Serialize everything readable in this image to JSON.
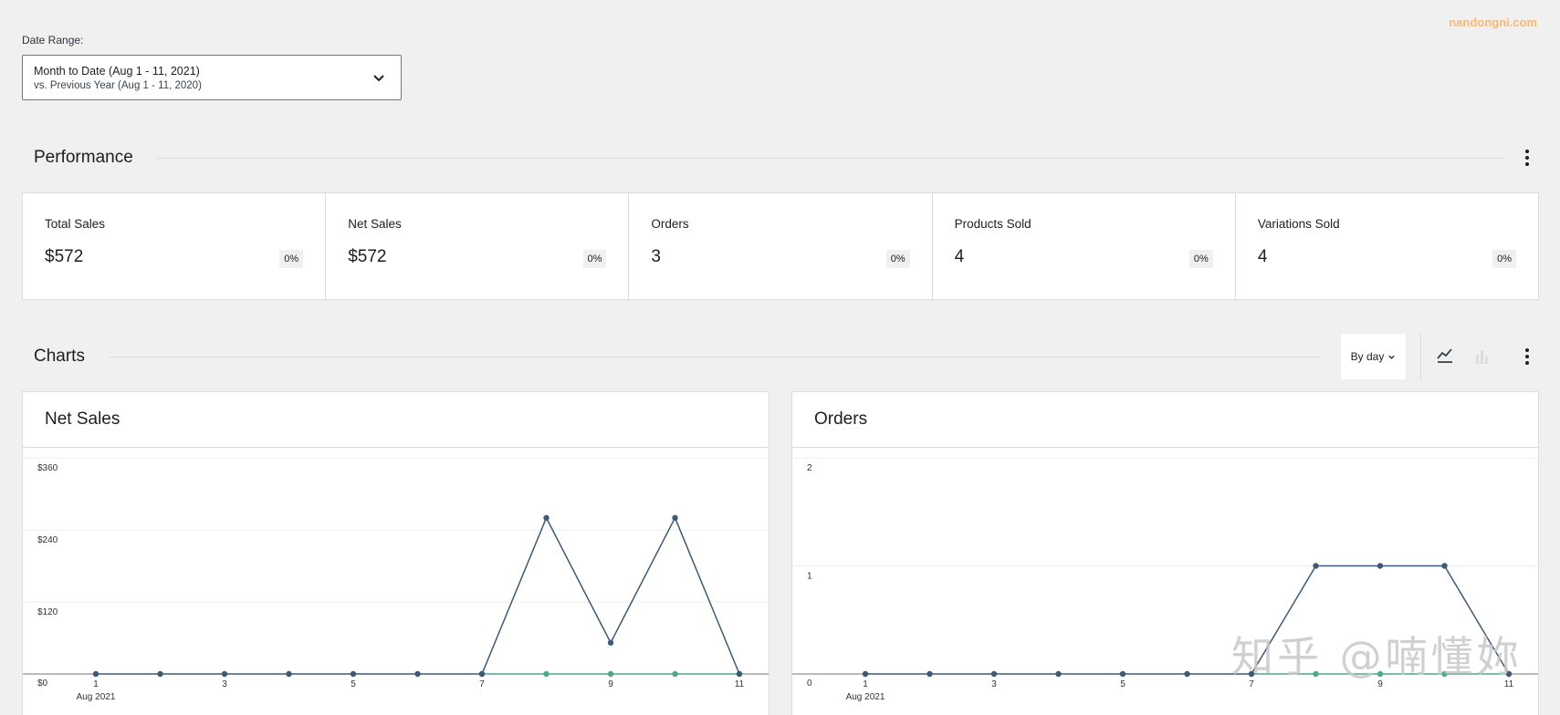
{
  "watermark_top": "nandongni.com",
  "watermark_bottom": "知乎 @喃懂妳",
  "date_range": {
    "label": "Date Range:",
    "primary": "Month to Date (Aug 1 - 11, 2021)",
    "secondary": "vs. Previous Year (Aug 1 - 11, 2020)"
  },
  "performance": {
    "title": "Performance",
    "cards": [
      {
        "label": "Total Sales",
        "value": "$572",
        "delta": "0%"
      },
      {
        "label": "Net Sales",
        "value": "$572",
        "delta": "0%"
      },
      {
        "label": "Orders",
        "value": "3",
        "delta": "0%"
      },
      {
        "label": "Products Sold",
        "value": "4",
        "delta": "0%"
      },
      {
        "label": "Variations Sold",
        "value": "4",
        "delta": "0%"
      }
    ]
  },
  "charts_section": {
    "title": "Charts",
    "interval": "By day"
  },
  "colors": {
    "current_series": "#3d5a74",
    "previous_series": "#4ea98a",
    "accent_watermark": "#f5b979"
  },
  "chart_data": [
    {
      "type": "line",
      "title": "Net Sales",
      "x": [
        1,
        2,
        3,
        4,
        5,
        6,
        7,
        8,
        9,
        10,
        11
      ],
      "x_tick_labels": [
        "1",
        "3",
        "5",
        "7",
        "9",
        "11"
      ],
      "x_first_sub": "Aug 2021",
      "y_ticks": [
        "$0",
        "$120",
        "$240",
        "$360"
      ],
      "ylim": [
        0,
        360
      ],
      "series": [
        {
          "values": [
            0,
            0,
            0,
            0,
            0,
            0,
            0,
            260,
            52,
            260,
            0
          ]
        },
        {
          "values": [
            null,
            null,
            null,
            null,
            null,
            null,
            0,
            0,
            0,
            0,
            0
          ]
        }
      ]
    },
    {
      "type": "line",
      "title": "Orders",
      "x": [
        1,
        2,
        3,
        4,
        5,
        6,
        7,
        8,
        9,
        10,
        11
      ],
      "x_tick_labels": [
        "1",
        "3",
        "5",
        "7",
        "9",
        "11"
      ],
      "x_first_sub": "Aug 2021",
      "y_ticks": [
        "0",
        "1",
        "2"
      ],
      "ylim": [
        0,
        2
      ],
      "series": [
        {
          "values": [
            0,
            0,
            0,
            0,
            0,
            0,
            0,
            1,
            1,
            1,
            0
          ]
        },
        {
          "values": [
            null,
            null,
            null,
            null,
            null,
            null,
            0,
            0,
            0,
            0,
            0
          ]
        }
      ]
    }
  ]
}
